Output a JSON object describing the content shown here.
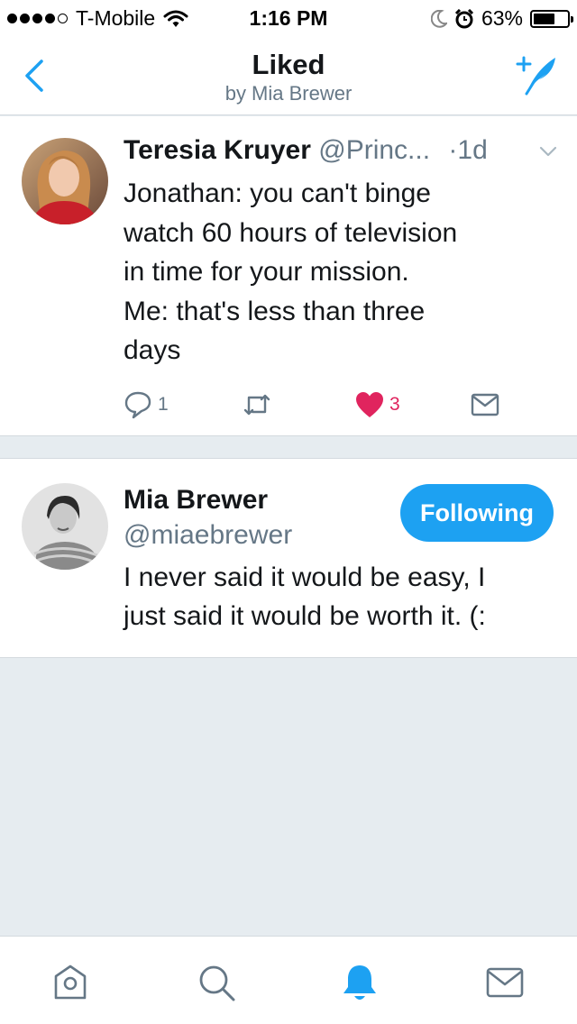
{
  "status_bar": {
    "carrier": "T-Mobile",
    "time": "1:16 PM",
    "battery": "63%",
    "battery_level": 0.63,
    "icons": [
      "signal-dots-icon",
      "wifi-icon",
      "moon-icon",
      "alarm-icon",
      "battery-icon"
    ]
  },
  "nav": {
    "title": "Liked",
    "subtitle": "by Mia Brewer",
    "back_icon": "back-chevron-icon",
    "compose_icon": "compose-tweet-icon"
  },
  "tweet": {
    "name": "Teresia Kruyer",
    "handle": "@Princ...",
    "separator": "·",
    "time": "1d",
    "text_lines": [
      "Jonathan: you can't binge",
      "watch 60 hours of television",
      "in time for your mission.",
      "Me: that's less than three",
      "days"
    ],
    "replies": "1",
    "likes": "3",
    "liked": true
  },
  "user": {
    "name": "Mia Brewer",
    "handle": "@miaebrewer",
    "follow_label": "Following",
    "bio_lines": [
      "I never said it would be easy, I",
      "just said it would be worth it. (:"
    ]
  },
  "tabs": [
    {
      "name": "home",
      "icon": "home-icon",
      "active": false
    },
    {
      "name": "search",
      "icon": "search-icon",
      "active": false
    },
    {
      "name": "notifications",
      "icon": "bell-icon",
      "active": true
    },
    {
      "name": "messages",
      "icon": "envelope-icon",
      "active": false
    }
  ],
  "colors": {
    "accent": "#1da1f2",
    "like": "#e0245e",
    "secondary_text": "#657786",
    "feed_background": "#e6ecf0"
  }
}
